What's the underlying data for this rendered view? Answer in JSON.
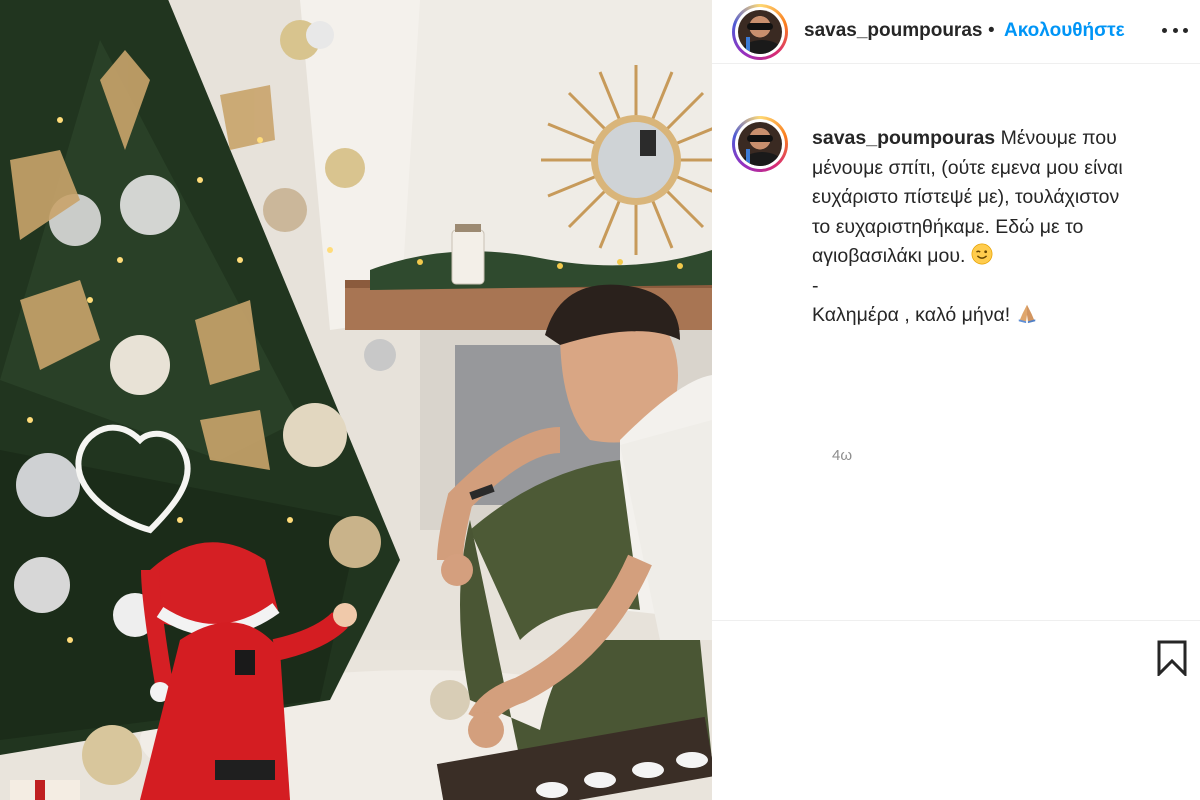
{
  "post": {
    "username": "savas_poumpouras",
    "follow_label": "Ακολουθήστε",
    "separator": "•",
    "caption": {
      "username": "savas_poumpouras",
      "lines": [
        "Μένουμε που",
        "μένουμε σπίτι, (ούτε εμενα μου είναι",
        "ευχάριστο πίστεψέ με), τουλάχιστον",
        "το ευχαριστηθήκαμε. Εδώ με το",
        "αγιοβασιλάκι μου.",
        "-",
        "Καλημέρα , καλό μήνα!"
      ],
      "emoji_after_line_5": "smiling-face-emoji",
      "emoji_after_line_7": "folded-hands-emoji"
    },
    "timestamp": "4ω"
  },
  "icons": {
    "more": "more-options-icon",
    "bookmark": "bookmark-icon"
  },
  "colors": {
    "accent": "#0095f6",
    "text": "#262626",
    "muted": "#8e8e8e",
    "border": "#efefef"
  }
}
